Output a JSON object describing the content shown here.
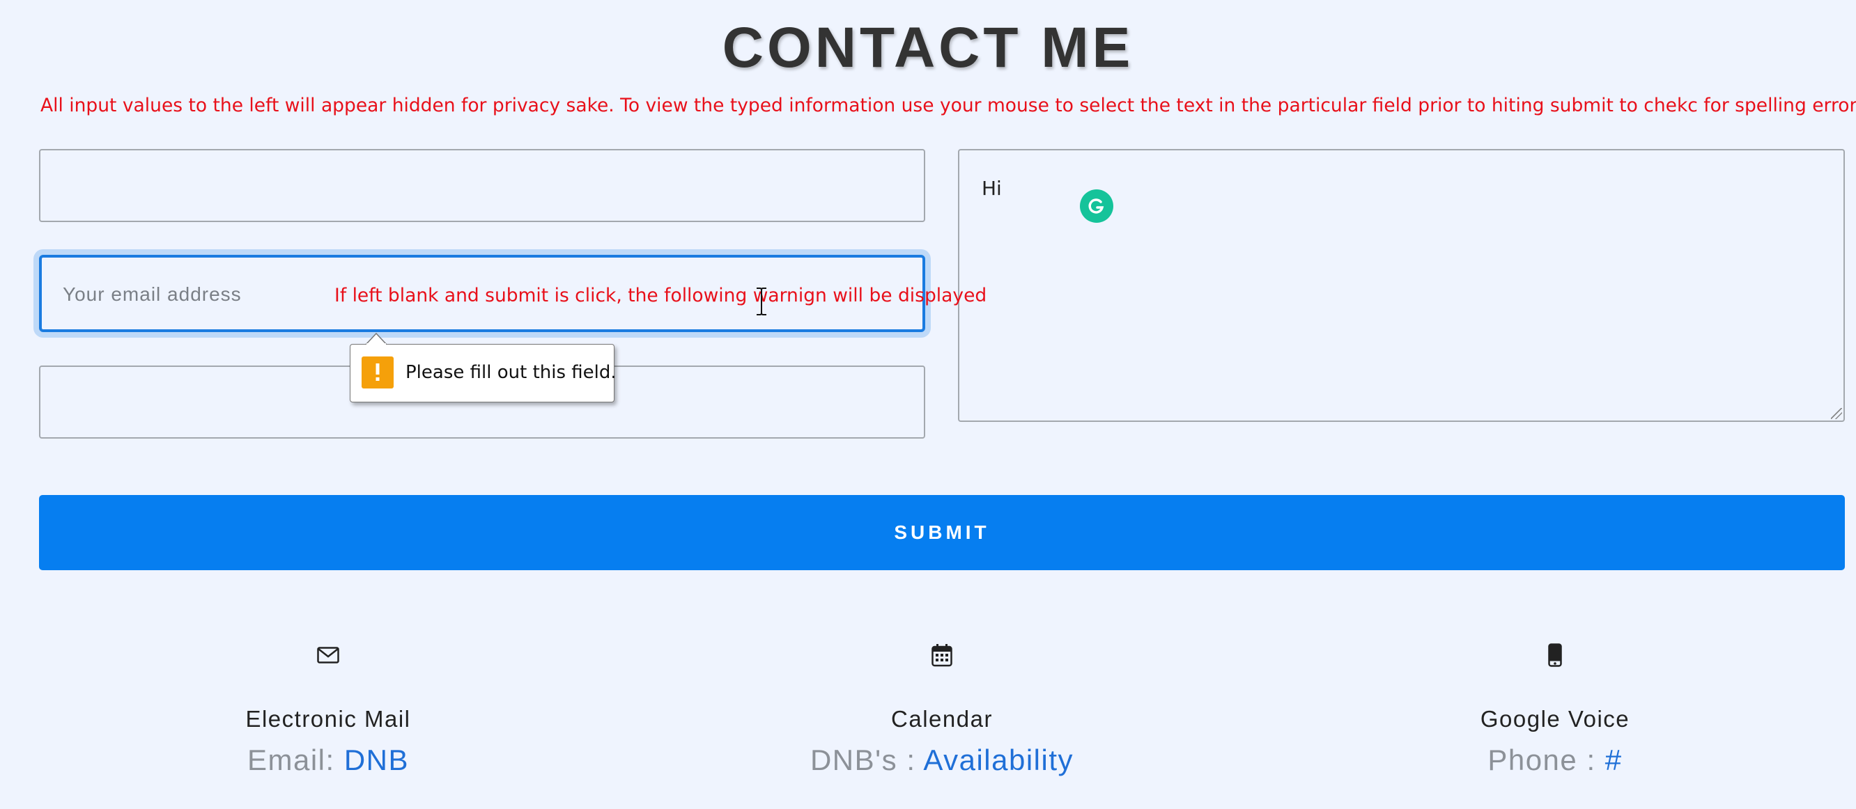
{
  "page": {
    "title": "CONTACT ME",
    "notice": "All input values to the left will appear hidden for privacy sake. To view the typed information use your mouse to select the text in the particular field prior to hiting submit to chekc for spelling errors"
  },
  "form": {
    "name_value": "",
    "email_placeholder": "Your email address",
    "phone_value": "",
    "message_value": "Hi",
    "annotation": "If left blank and submit is click, the following warnign will be displayed",
    "validation_message": "Please fill out this field.",
    "submit_label": "SUBMIT"
  },
  "contact_info": [
    {
      "icon": "envelope-icon",
      "label": "Electronic Mail",
      "prefix": "Email: ",
      "link": "DNB"
    },
    {
      "icon": "calendar-icon",
      "label": "Calendar",
      "prefix": "DNB's : ",
      "link": "Availability"
    },
    {
      "icon": "mobile-phone-icon",
      "label": "Google Voice",
      "prefix": "Phone : ",
      "link": "#"
    }
  ],
  "colors": {
    "background": "#eff4fe",
    "accent": "#067ef0",
    "warning_text": "#e8101a",
    "link": "#1f6fd7",
    "grammarly": "#15c39a",
    "warning_icon": "#f5a00a"
  }
}
